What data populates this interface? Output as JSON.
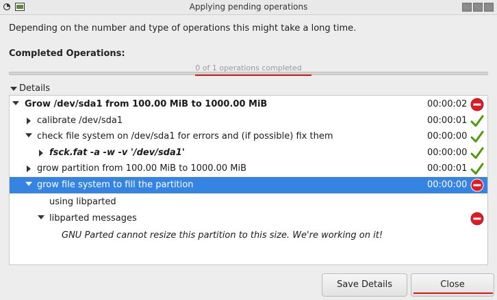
{
  "window": {
    "title": "Applying pending operations"
  },
  "description": "Depending on the number and type of operations this might take a long time.",
  "completed": {
    "label": "Completed Operations:",
    "progress_text": "0 of 1 operations completed",
    "progress_fraction": 0
  },
  "details": {
    "label": "Details",
    "rows": [
      {
        "label": "Grow /dev/sda1 from 100.00 MiB to 1000.00 MiB",
        "time": "00:00:02",
        "status": "error-icon"
      },
      {
        "label": "calibrate /dev/sda1",
        "time": "00:00:01",
        "status": "success-check-icon"
      },
      {
        "label": "check file system on /dev/sda1 for errors and (if possible) fix them",
        "time": "00:00:00",
        "status": "success-check-icon"
      },
      {
        "label": "fsck.fat -a -w -v '/dev/sda1'",
        "time": "00:00:00",
        "status": "success-check-icon"
      },
      {
        "label": "grow partition from 100.00 MiB to 1000.00 MiB",
        "time": "00:00:01",
        "status": "success-check-icon"
      },
      {
        "label": "grow file system to fill the partition",
        "time": "00:00:00",
        "status": "error-icon"
      },
      {
        "label": "using libparted",
        "time": "",
        "status": ""
      },
      {
        "label": "libparted messages",
        "time": "",
        "status": "error-icon"
      },
      {
        "label": "GNU Parted cannot resize this partition to this size.  We're working on it!",
        "time": "",
        "status": ""
      }
    ]
  },
  "buttons": {
    "save_details": "Save Details",
    "close": "Close"
  },
  "colors": {
    "selection": "#3584e4",
    "error": "#e01b24",
    "success": "#4e9a06"
  }
}
